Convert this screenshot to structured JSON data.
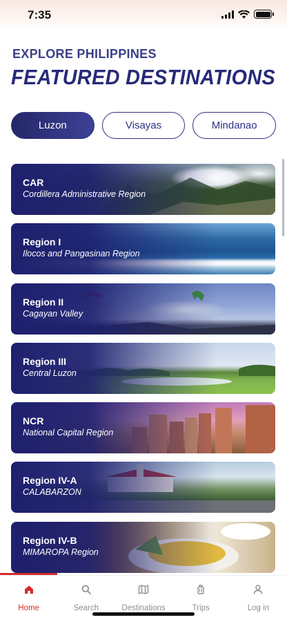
{
  "status_bar": {
    "time": "7:35"
  },
  "header": {
    "eyebrow": "EXPLORE PHILIPPINES",
    "title": "FEATURED DESTINATIONS"
  },
  "island_tabs": [
    {
      "label": "Luzon",
      "active": true
    },
    {
      "label": "Visayas",
      "active": false
    },
    {
      "label": "Mindanao",
      "active": false
    }
  ],
  "regions": [
    {
      "name": "CAR",
      "subtitle": "Cordillera Administrative Region",
      "image": "mountain-landscape"
    },
    {
      "name": "Region I",
      "subtitle": "Ilocos and Pangasinan Region",
      "image": "ocean-waves"
    },
    {
      "name": "Region II",
      "subtitle": "Cagayan Valley",
      "image": "paragliders-sky"
    },
    {
      "name": "Region III",
      "subtitle": "Central Luzon",
      "image": "golf-course-field"
    },
    {
      "name": "NCR",
      "subtitle": "National Capital Region",
      "image": "city-skyline"
    },
    {
      "name": "Region IV-A",
      "subtitle": "CALABARZON",
      "image": "heritage-building"
    },
    {
      "name": "Region IV-B",
      "subtitle": "MIMAROPA Region",
      "image": "food-platter"
    }
  ],
  "bottom_nav": [
    {
      "label": "Home",
      "icon": "home-icon",
      "active": true
    },
    {
      "label": "Search",
      "icon": "search-icon",
      "active": false
    },
    {
      "label": "Destinations",
      "icon": "map-icon",
      "active": false
    },
    {
      "label": "Trips",
      "icon": "luggage-icon",
      "active": false
    },
    {
      "label": "Log in",
      "icon": "user-icon",
      "active": false
    }
  ],
  "colors": {
    "primary": "#2e3182",
    "accent": "#d62b2b",
    "nav_inactive": "#8c8d96"
  }
}
